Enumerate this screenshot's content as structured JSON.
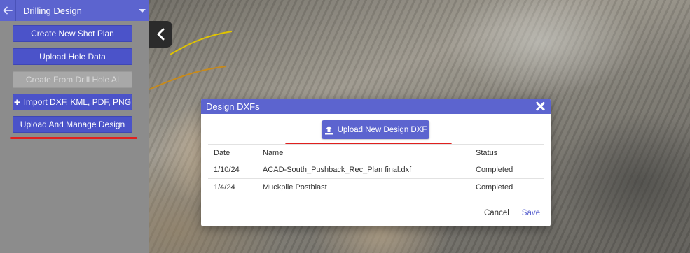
{
  "sidebar": {
    "title": "Drilling Design",
    "buttons": [
      {
        "label": "Create New Shot Plan",
        "enabled": true
      },
      {
        "label": "Upload Hole Data",
        "enabled": true
      },
      {
        "label": "Create From Drill Hole AI",
        "enabled": false
      },
      {
        "label": "Import DXF, KML, PDF, PNG",
        "enabled": true,
        "icon": "plus-icon"
      },
      {
        "label": "Upload And Manage Design",
        "enabled": true
      }
    ]
  },
  "modal": {
    "title": "Design DXFs",
    "upload_label": "Upload New Design DXF",
    "columns": {
      "date": "Date",
      "name": "Name",
      "status": "Status"
    },
    "rows": [
      {
        "date": "1/10/24",
        "name": "ACAD-South_Pushback_Rec_Plan final.dxf",
        "status": "Completed"
      },
      {
        "date": "1/4/24",
        "name": "Muckpile Postblast",
        "status": "Completed"
      }
    ],
    "cancel_label": "Cancel",
    "save_label": "Save"
  },
  "colors": {
    "accent": "#5c64cf",
    "annotation": "#e0201e",
    "disabled": "#a8a8a8"
  }
}
